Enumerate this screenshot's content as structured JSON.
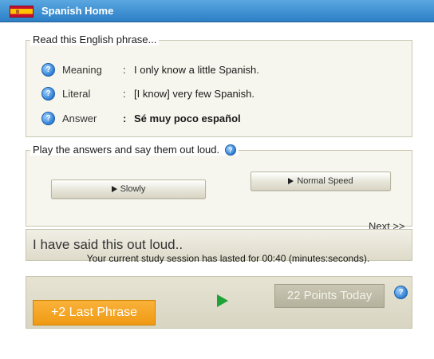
{
  "header": {
    "title": "Spanish Home",
    "flag_icon": "spain-flag-icon"
  },
  "phrase_box": {
    "legend": "Read this English phrase...",
    "rows": [
      {
        "label": "Meaning",
        "colon": ":",
        "value": "I only know a little Spanish."
      },
      {
        "label": "Literal",
        "colon": ":",
        "value": "[I know] very few Spanish."
      },
      {
        "label": "Answer",
        "colon": ":",
        "value": "Sé muy poco español"
      }
    ]
  },
  "play_box": {
    "legend": "Play the answers and say them out loud.",
    "slowly_label": "Slowly",
    "normal_label": "Normal Speed"
  },
  "next_label": "Next >>",
  "said_label": "I have said this out loud..",
  "session_text": "Your current study session has lasted for 00:40 (minutes:seconds).",
  "bottom": {
    "last_phrase_label": "+2 Last Phrase",
    "points_label": "22 Points Today"
  },
  "colors": {
    "header": "#2c7fc6",
    "accent_orange": "#f09a13",
    "play_green": "#1ea338"
  }
}
